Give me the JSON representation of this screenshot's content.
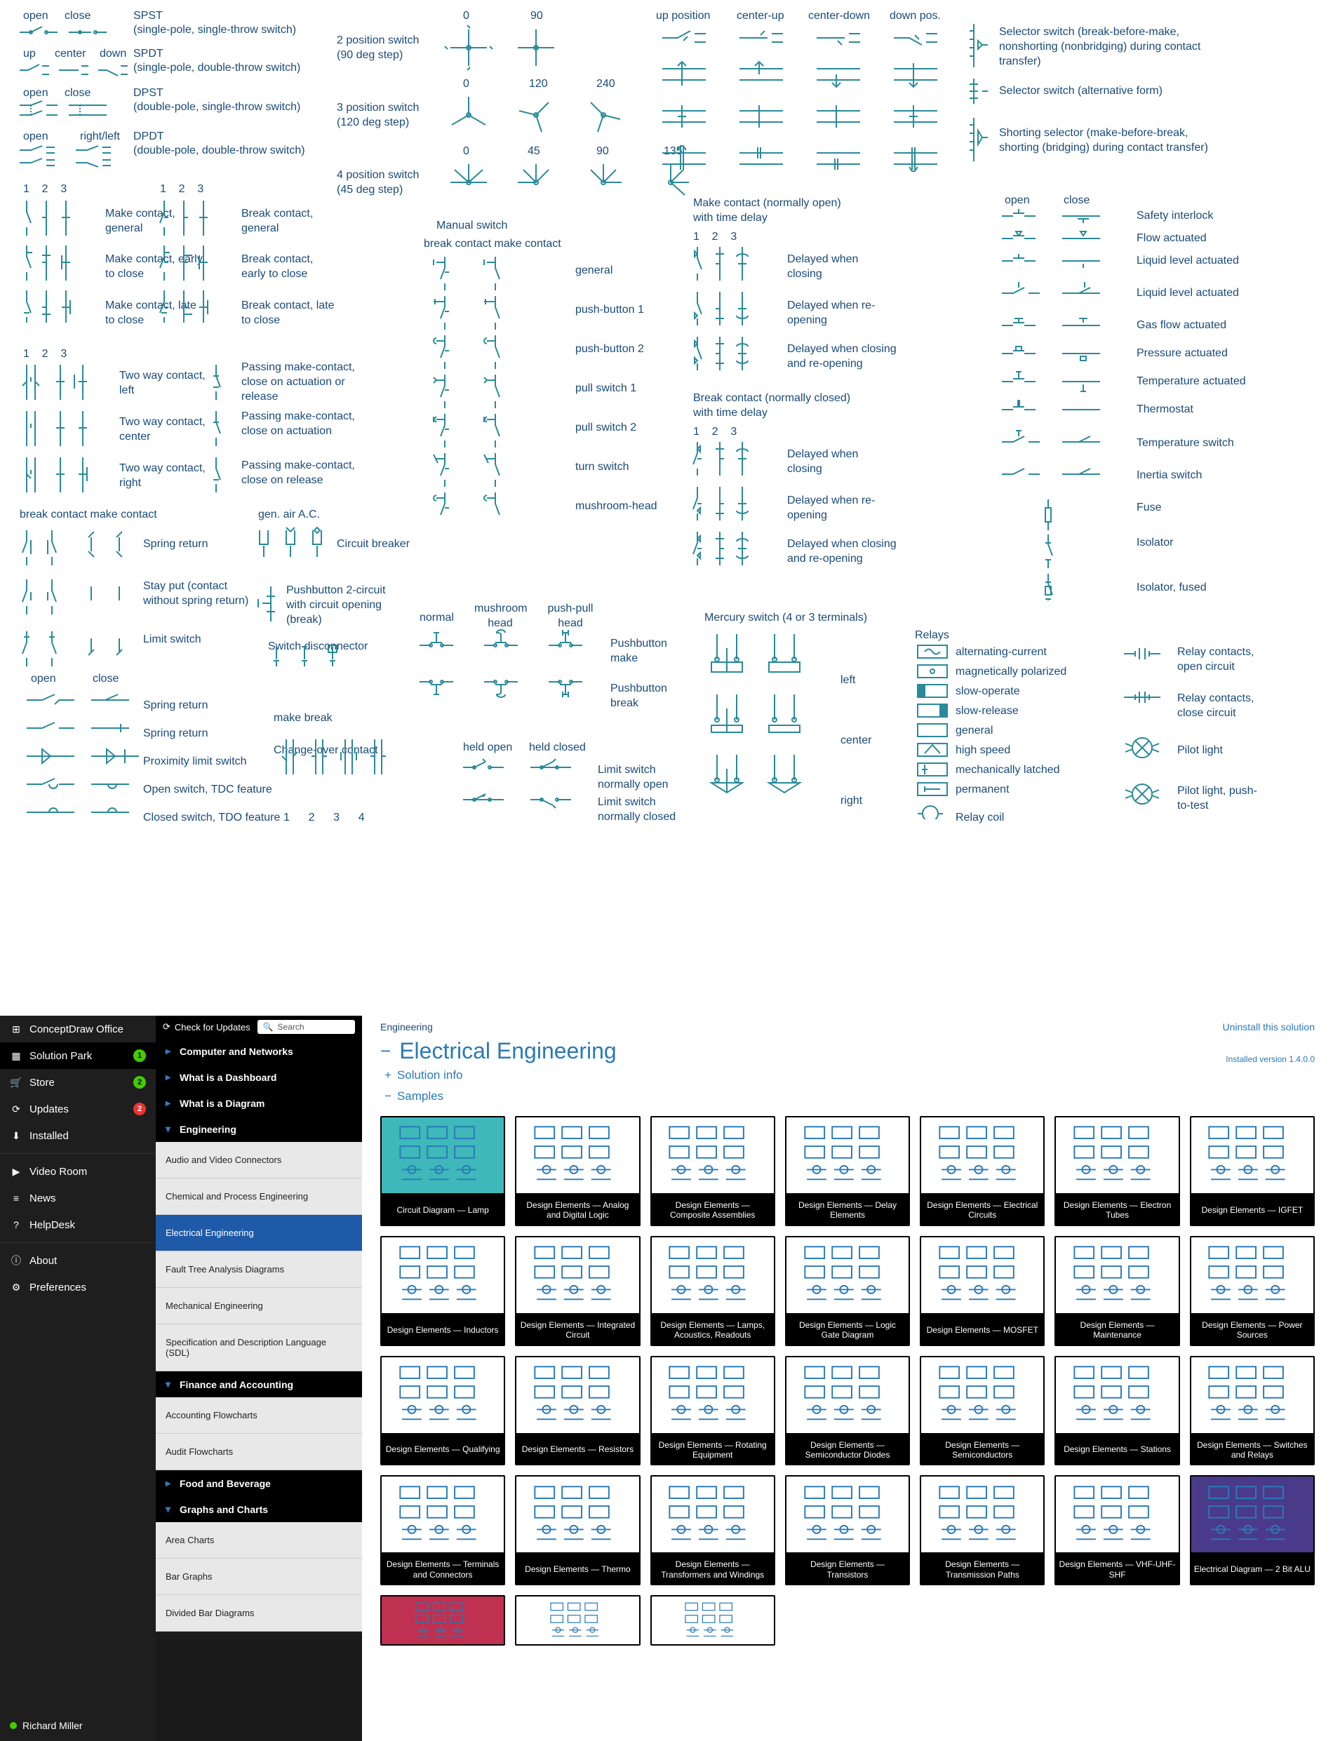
{
  "diagram": {
    "col1": {
      "spst": {
        "hdr": "SPST",
        "sub": "(single-pole, single-throw switch)",
        "open": "open",
        "close": "close"
      },
      "spdt": {
        "hdr": "SPDT",
        "sub": "(single-pole, double-throw switch)",
        "up": "up",
        "center": "center",
        "down": "down"
      },
      "dpst": {
        "hdr": "DPST",
        "sub": "(double-pole, single-throw switch)",
        "open": "open",
        "close": "close"
      },
      "dpdt": {
        "hdr": "DPDT",
        "sub": "(double-pole, double-throw switch)",
        "open": "open",
        "rl": "right/left"
      },
      "nums": "1    2    3",
      "make_general": "Make contact, general",
      "make_early": "Make contact, early to close",
      "make_late": "Make contact, late to close",
      "break_general": "Break contact, general",
      "break_early": "Break contact, early to close",
      "break_late": "Break contact, late to close",
      "two_left": "Two way contact, left",
      "two_center": "Two way contact, center",
      "two_right": "Two way contact, right",
      "passing1": "Passing make-contact, close on actuation or release",
      "passing2": "Passing make-contact, close on actuation",
      "passing3": "Passing make-contact, close on release",
      "bc_mc": "break contact make contact",
      "spring": "Spring return",
      "stay": "Stay put (contact without spring return)",
      "limit": "Limit switch",
      "openlbl": "open",
      "closelbl": "close",
      "spring2": "Spring return",
      "spring3": "Spring return",
      "prox": "Proximity limit switch",
      "open_tdc": "Open switch, TDC feature",
      "closed_tdo": "Closed switch, TDO feature",
      "gen_air": "gen.  air  A.C.",
      "cb": "Circuit breaker",
      "pb2": "Pushbutton 2-circuit with circuit opening (break)",
      "swd": "Switch disconnector",
      "mb": "make break",
      "coc": "Change-over contact",
      "n1234": "1      2      3      4"
    },
    "col2": {
      "pos2": "2 position switch (90 deg step)",
      "pos3": "3 position switch (120 deg step)",
      "pos4": "4 position switch (45 deg step)",
      "a0": "0",
      "a90": "90",
      "a120": "120",
      "a240": "240",
      "a45": "45",
      "a135": "135",
      "manual": "Manual switch",
      "bc_mc2": "break contact make contact",
      "general": "general",
      "pb1": "push-button 1",
      "pb2l": "push-button 2",
      "pull1": "pull switch 1",
      "pull2": "pull switch 2",
      "turn": "turn switch",
      "mush": "mushroom-head",
      "normal": "normal",
      "mh": "mushroom head",
      "pp": "push-pull head",
      "pbmake": "Pushbutton make",
      "pbbreak": "Pushbutton break",
      "ho": "held open",
      "hc": "held closed",
      "lsno": "Limit switch normally open",
      "lsnc": "Limit switch normally closed"
    },
    "col3": {
      "up": "up position",
      "cu": "center-up",
      "cd": "center-down",
      "dp": "down pos.",
      "mcno": "Make contact (normally open) with time delay",
      "n123a": "1    2    3",
      "dc": "Delayed when closing",
      "dro": "Delayed when re-opening",
      "dcro": "Delayed when closing and re-opening",
      "bcnc": "Break contact (normally closed) with time delay",
      "n123b": "1    2    3",
      "merc": "Mercury switch (4 or 3 terminals)",
      "left": "left",
      "center": "center",
      "right": "right"
    },
    "col4": {
      "sel1": "Selector switch (break-before-make, nonshorting (nonbridging) during contact transfer)",
      "sel2": "Selector switch (alternative form)",
      "sel3": "Shorting selector (make-before-break, shorting (bridging) during contact transfer)",
      "open": "open",
      "close": "close",
      "safety": "Safety interlock",
      "flow": "Flow actuated",
      "liq1": "Liquid level actuated",
      "liq2": "Liquid level actuated",
      "gas": "Gas flow actuated",
      "pressure": "Pressure actuated",
      "temp": "Temperature actuated",
      "thermo": "Thermostat",
      "tswitch": "Temperature switch",
      "inertia": "Inertia switch",
      "fuse": "Fuse",
      "iso": "Isolator",
      "isof": "Isolator, fused",
      "relays": "Relays",
      "r_ac": "alternating-current",
      "r_mag": "magnetically polarized",
      "r_slow": "slow-operate",
      "r_slowr": "slow-release",
      "r_gen": "general",
      "r_hs": "high speed",
      "r_ml": "mechanically latched",
      "r_perm": "permanent",
      "r_coil": "Relay coil",
      "rc_open": "Relay contacts, open circuit",
      "rc_close": "Relay contacts, close circuit",
      "pilot": "Pilot light",
      "pilot2": "Pilot light, push-to-test"
    }
  },
  "app": {
    "sidebar1": {
      "office": "ConceptDraw Office",
      "sp": "Solution Park",
      "store": "Store",
      "updates": "Updates",
      "installed": "Installed",
      "video": "Video Room",
      "news": "News",
      "help": "HelpDesk",
      "about": "About",
      "pref": "Preferences",
      "user": "Richard Miller",
      "badge_sp": "1",
      "badge_store": "2",
      "badge_upd": "2"
    },
    "sidebar2": {
      "check": "Check for Updates",
      "search": "Search",
      "cats": {
        "cn": "Computer and Networks",
        "wd": "What is a Dashboard",
        "wdi": "What is a Diagram",
        "eng": "Engineering",
        "fin": "Finance and Accounting",
        "food": "Food and Beverage",
        "gc": "Graphs and Charts"
      },
      "items": {
        "av": "Audio and Video Connectors",
        "chem": "Chemical and Process Engineering",
        "ee": "Electrical Engineering",
        "fault": "Fault Tree Analysis Diagrams",
        "mech": "Mechanical Engineering",
        "sdl": "Specification and Description Language (SDL)",
        "acc": "Accounting Flowcharts",
        "audit": "Audit Flowcharts",
        "area": "Area Charts",
        "bar": "Bar Graphs",
        "div": "Divided Bar Diagrams"
      }
    },
    "main": {
      "crumb": "Engineering",
      "uninstall": "Uninstall this solution",
      "title": "Electrical Engineering",
      "info": "Solution info",
      "samples": "Samples",
      "ver": "Installed version 1.4.0.0",
      "cards": [
        "Circuit Diagram — Lamp",
        "Design Elements — Analog and Digital Logic",
        "Design Elements — Composite Assemblies",
        "Design Elements — Delay Elements",
        "Design Elements — Electrical Circuits",
        "Design Elements — Electron Tubes",
        "Design Elements — IGFET",
        "Design Elements — Inductors",
        "Design Elements — Integrated Circuit",
        "Design Elements — Lamps, Acoustics, Readouts",
        "Design Elements — Logic Gate Diagram",
        "Design Elements — MOSFET",
        "Design Elements — Maintenance",
        "Design Elements — Power Sources",
        "Design Elements — Qualifying",
        "Design Elements — Resistors",
        "Design Elements — Rotating Equipment",
        "Design Elements — Semiconductor Diodes",
        "Design Elements — Semiconductors",
        "Design Elements — Stations",
        "Design Elements — Switches and Relays",
        "Design Elements — Terminals and Connectors",
        "Design Elements — Thermo",
        "Design Elements — Transformers and Windings",
        "Design Elements — Transistors",
        "Design Elements — Transmission Paths",
        "Design Elements — VHF-UHF-SHF",
        "Electrical Diagram — 2 Bit ALU"
      ]
    }
  }
}
